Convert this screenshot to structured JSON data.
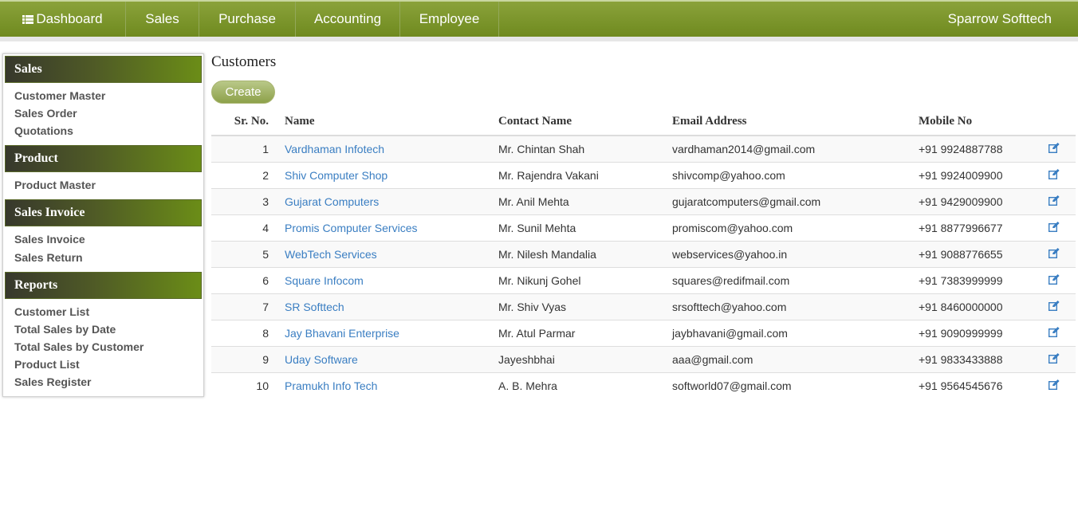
{
  "nav": {
    "items": [
      {
        "label": "Dashboard",
        "icon": "list-icon"
      },
      {
        "label": "Sales"
      },
      {
        "label": "Purchase"
      },
      {
        "label": "Accounting"
      },
      {
        "label": "Employee"
      }
    ],
    "brand": "Sparrow Softtech"
  },
  "sidebar": {
    "sections": [
      {
        "title": "Sales",
        "links": [
          "Customer Master",
          "Sales Order",
          "Quotations"
        ]
      },
      {
        "title": "Product",
        "links": [
          "Product Master"
        ]
      },
      {
        "title": "Sales Invoice",
        "links": [
          "Sales Invoice",
          "Sales Return"
        ]
      },
      {
        "title": "Reports",
        "links": [
          "Customer List",
          "Total Sales by Date",
          "Total Sales by Customer",
          "Product List",
          "Sales Register"
        ]
      }
    ]
  },
  "main": {
    "title": "Customers",
    "create_label": "Create",
    "columns": [
      "Sr. No.",
      "Name",
      "Contact Name",
      "Email Address",
      "Mobile No"
    ],
    "rows": [
      {
        "sr": "1",
        "name": "Vardhaman Infotech",
        "contact": "Mr. Chintan Shah",
        "email": "vardhaman2014@gmail.com",
        "mobile": "+91 9924887788"
      },
      {
        "sr": "2",
        "name": "Shiv Computer Shop",
        "contact": "Mr. Rajendra Vakani",
        "email": "shivcomp@yahoo.com",
        "mobile": "+91 9924009900"
      },
      {
        "sr": "3",
        "name": "Gujarat Computers",
        "contact": "Mr. Anil Mehta",
        "email": "gujaratcomputers@gmail.com",
        "mobile": "+91 9429009900"
      },
      {
        "sr": "4",
        "name": "Promis Computer Services",
        "contact": "Mr. Sunil Mehta",
        "email": "promiscom@yahoo.com",
        "mobile": "+91 8877996677"
      },
      {
        "sr": "5",
        "name": "WebTech Services",
        "contact": "Mr. Nilesh Mandalia",
        "email": "webservices@yahoo.in",
        "mobile": "+91 9088776655"
      },
      {
        "sr": "6",
        "name": "Square Infocom",
        "contact": "Mr. Nikunj Gohel",
        "email": "squares@redifmail.com",
        "mobile": "+91 7383999999"
      },
      {
        "sr": "7",
        "name": "SR Softtech",
        "contact": "Mr. Shiv Vyas",
        "email": "srsofttech@yahoo.com",
        "mobile": "+91 8460000000"
      },
      {
        "sr": "8",
        "name": "Jay Bhavani Enterprise",
        "contact": "Mr. Atul Parmar",
        "email": "jaybhavani@gmail.com",
        "mobile": "+91 9090999999"
      },
      {
        "sr": "9",
        "name": "Uday Software",
        "contact": "Jayeshbhai",
        "email": "aaa@gmail.com",
        "mobile": "+91 9833433888"
      },
      {
        "sr": "10",
        "name": "Pramukh Info Tech",
        "contact": "A. B. Mehra",
        "email": "softworld07@gmail.com",
        "mobile": "+91 9564545676"
      }
    ],
    "edit_icon": "edit-icon"
  },
  "colors": {
    "nav_green": "#7a9428",
    "link_blue": "#3a7ec2",
    "sidebar_header_dark": "#37382c",
    "sidebar_header_green": "#6b8d17"
  }
}
